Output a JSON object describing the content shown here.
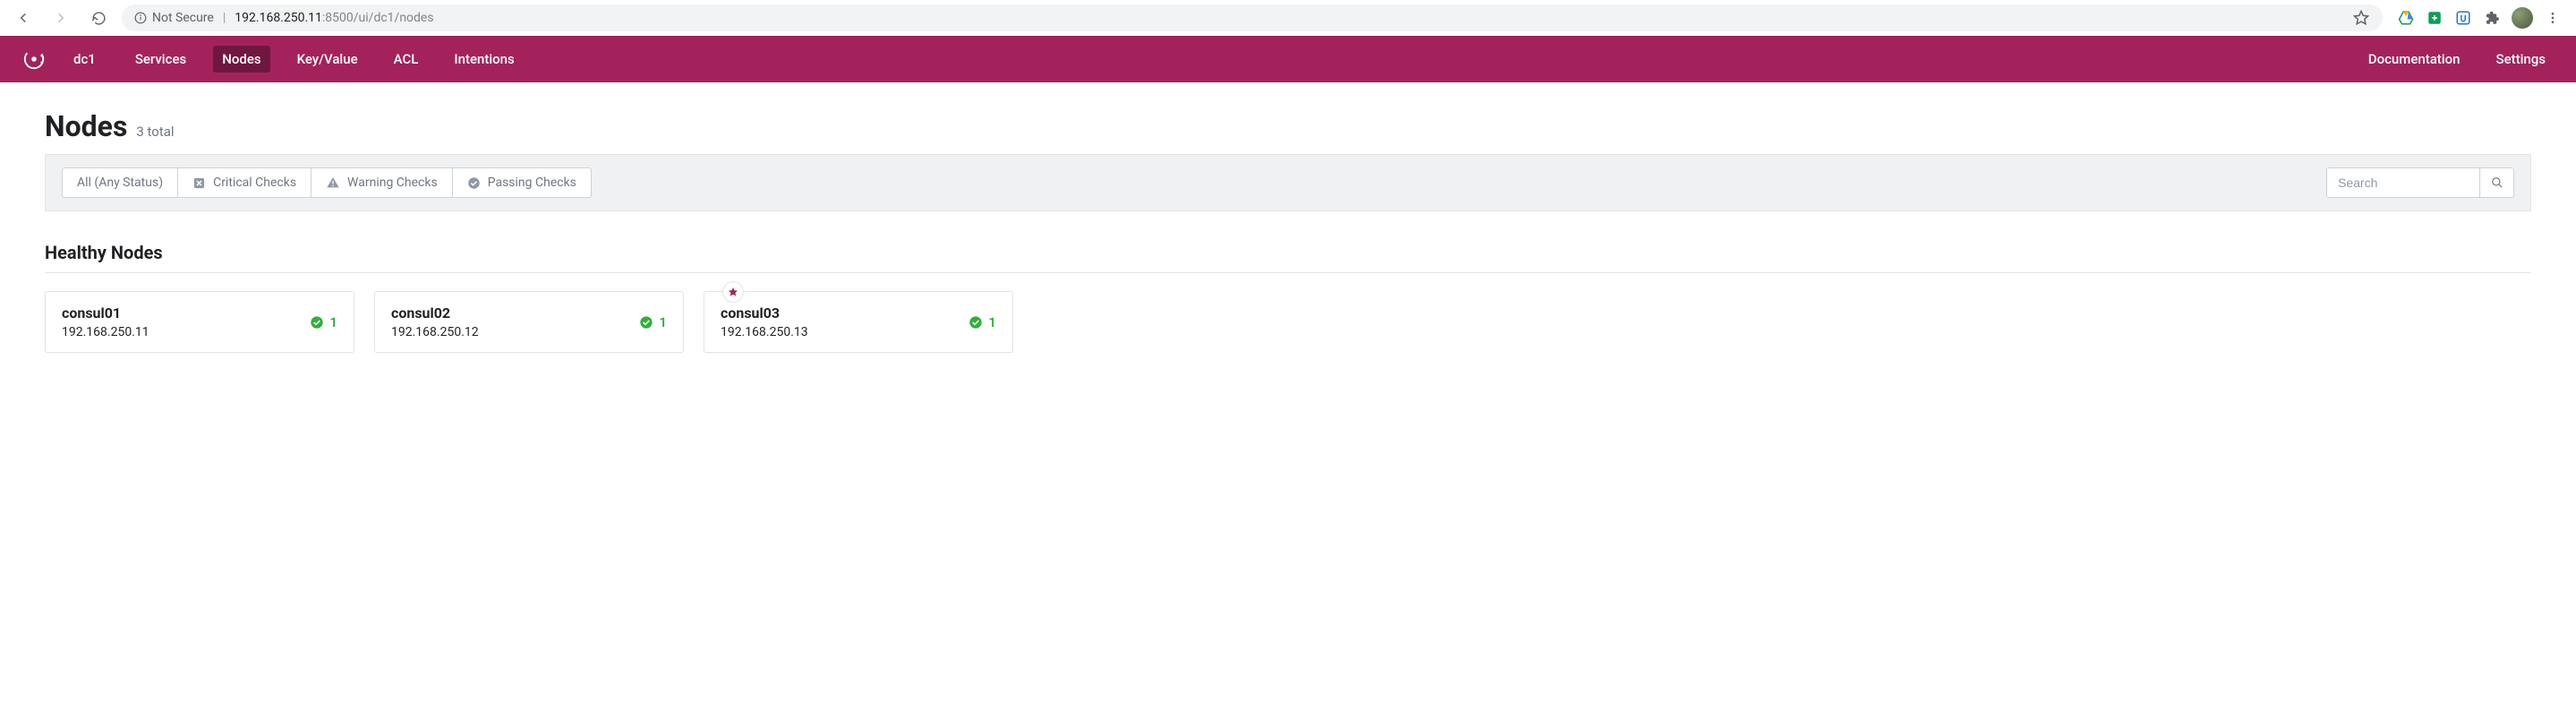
{
  "browser": {
    "secure_label": "Not Secure",
    "url_host": "192.168.250.11",
    "url_path": ":8500/ui/dc1/nodes"
  },
  "nav": {
    "datacenter": "dc1",
    "items": [
      "Services",
      "Nodes",
      "Key/Value",
      "ACL",
      "Intentions"
    ],
    "active": "Nodes",
    "right": [
      "Documentation",
      "Settings"
    ]
  },
  "page": {
    "title": "Nodes",
    "count_text": "3 total"
  },
  "filters": {
    "all": "All (Any Status)",
    "critical": "Critical Checks",
    "warning": "Warning Checks",
    "passing": "Passing Checks",
    "search_placeholder": "Search"
  },
  "healthy": {
    "title": "Healthy Nodes",
    "nodes": [
      {
        "name": "consul01",
        "ip": "192.168.250.11",
        "passing": "1",
        "leader": false
      },
      {
        "name": "consul02",
        "ip": "192.168.250.12",
        "passing": "1",
        "leader": false
      },
      {
        "name": "consul03",
        "ip": "192.168.250.13",
        "passing": "1",
        "leader": true
      }
    ]
  }
}
